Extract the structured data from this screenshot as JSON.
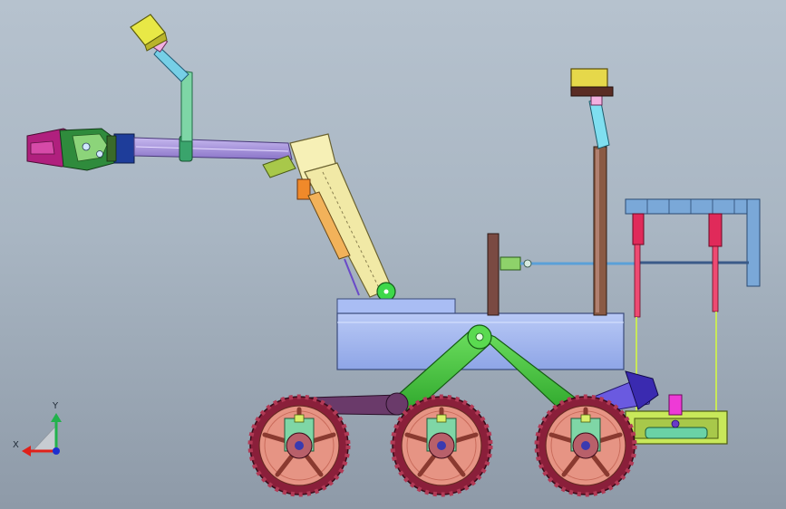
{
  "viewport": {
    "background_top": "#b6c2ce",
    "background_bottom": "#8e9aa8"
  },
  "axis_triad": {
    "x_label": "X",
    "y_label": "Y",
    "x_color": "#e0201a",
    "y_color": "#22b24c",
    "z_color": "#1d2fd0"
  },
  "model": {
    "name": "rover-robot-assembly",
    "parts": [
      "gripper",
      "arm-tube",
      "arm-elbow",
      "camera-mast",
      "camera-head",
      "lift-cylinder",
      "body-chassis",
      "rocker-linkage",
      "wheels",
      "rear-rack",
      "rear-camera-mast",
      "rear-camera-head",
      "battery-box"
    ],
    "colors": {
      "body": "#9fb5f0",
      "linkage": "#3ec43a",
      "wheel_rim": "#e69484",
      "wheel_tire": "#8a1f3a",
      "arm": "#9c86d8",
      "gripper": "#b0207e",
      "camera": "#e6e64a",
      "mast": "#7a4a36",
      "rack": "#7aa8d8",
      "rod": "#e02a5a"
    }
  }
}
